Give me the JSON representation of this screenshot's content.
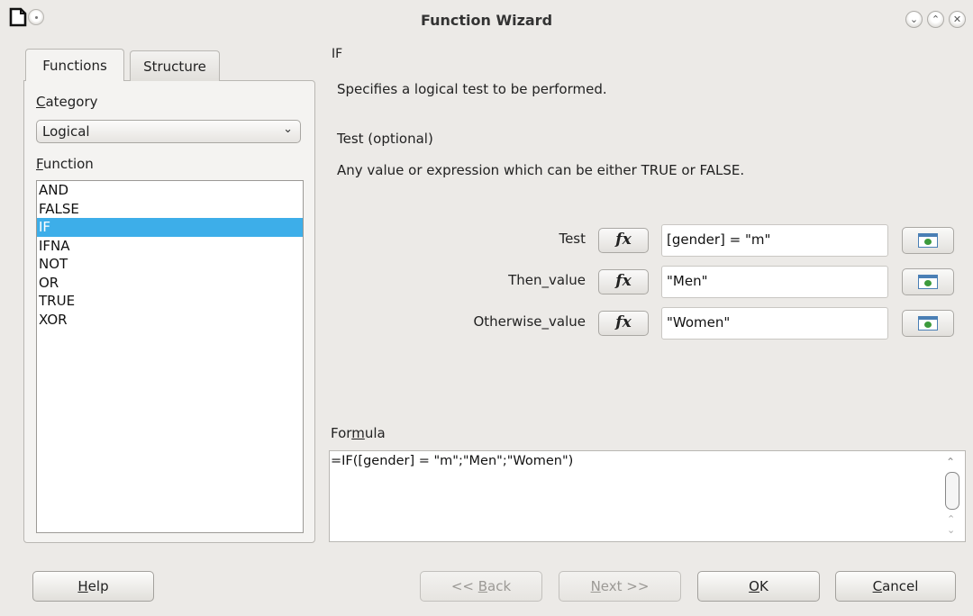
{
  "window": {
    "title": "Function Wizard",
    "controls": [
      "minimize",
      "maximize",
      "close"
    ]
  },
  "tabs": [
    {
      "label": "Functions",
      "active": true
    },
    {
      "label": "Structure",
      "active": false
    }
  ],
  "category": {
    "label_mnemonic": "C",
    "label_rest": "ategory",
    "selected": "Logical"
  },
  "function": {
    "label_mnemonic": "F",
    "label_rest": "unction",
    "items": [
      "AND",
      "FALSE",
      "IF",
      "IFNA",
      "NOT",
      "OR",
      "TRUE",
      "XOR"
    ],
    "selected": "IF"
  },
  "details": {
    "name": "IF",
    "description": "Specifies a logical test to be performed.",
    "argument_title": "Test (optional)",
    "argument_description": "Any value or expression which can be either TRUE or FALSE."
  },
  "arguments": [
    {
      "label": "Test",
      "fx": "fx",
      "value": "[gender] = \"m\""
    },
    {
      "label": "Then_value",
      "fx": "fx",
      "value": "\"Men\""
    },
    {
      "label": "Otherwise_value",
      "fx": "fx",
      "value": "\"Women\""
    }
  ],
  "formula": {
    "label_before": "For",
    "label_mnemonic": "m",
    "label_after": "ula",
    "value": "=IF([gender] = \"m\";\"Men\";\"Women\")"
  },
  "buttons": {
    "help": {
      "mnemonic": "H",
      "rest": "elp"
    },
    "back": {
      "prefix": "<< ",
      "mnemonic": "B",
      "rest": "ack"
    },
    "next": {
      "mnemonic": "N",
      "rest": "ext >>"
    },
    "ok": {
      "mnemonic": "O",
      "rest": "K"
    },
    "cancel": {
      "mnemonic": "C",
      "rest": "ancel"
    }
  },
  "colors": {
    "selection": "#3daee9",
    "window_bg": "#eceae7"
  },
  "icons": {
    "app": "document-icon",
    "window_menu": "window-menu-icon",
    "shrink": "shrink-dialog-icon"
  }
}
